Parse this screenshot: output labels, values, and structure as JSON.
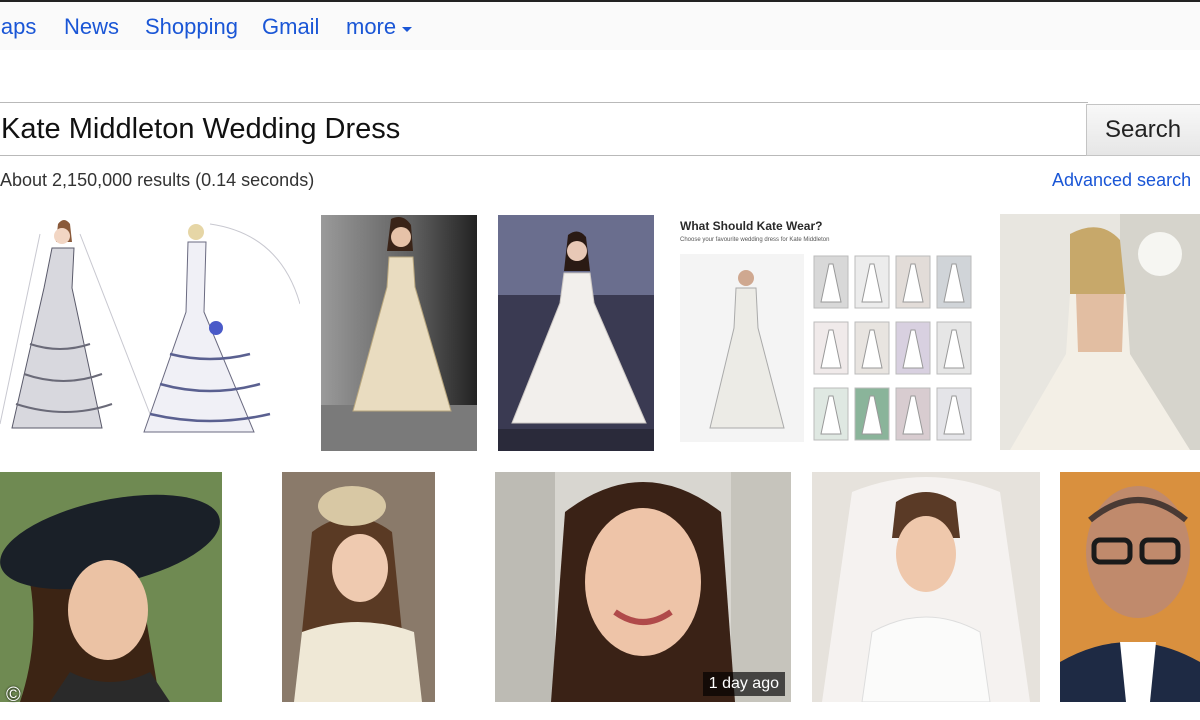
{
  "nav": {
    "maps": "laps",
    "news": "News",
    "shopping": "Shopping",
    "gmail": "Gmail",
    "more": "more"
  },
  "search": {
    "query": "Kate Middleton Wedding Dress",
    "button_label": "Search"
  },
  "results": {
    "stats": "About 2,150,000 results (0.14 seconds)",
    "advanced_link": "Advanced search"
  },
  "images": {
    "row1": [
      {
        "id": "sketch",
        "subject": "wedding dress sketches"
      },
      {
        "id": "gown-runway",
        "subject": "model in ivory gown"
      },
      {
        "id": "ballgown",
        "subject": "model in tulle ballgown"
      },
      {
        "id": "mosaic",
        "subject": "dress poll grid",
        "title": "What Should Kate Wear?",
        "subtitle": "Choose your favourite wedding dress for Kate Middleton"
      },
      {
        "id": "backless",
        "subject": "backless bridal gown"
      }
    ],
    "row2": [
      {
        "id": "hat",
        "subject": "woman in wide hat"
      },
      {
        "id": "fascinator",
        "subject": "woman with fascinator"
      },
      {
        "id": "portrait",
        "subject": "smiling woman portrait",
        "badge": "1 day ago"
      },
      {
        "id": "bride",
        "subject": "bride with veil"
      },
      {
        "id": "designer",
        "subject": "man with glasses"
      }
    ]
  },
  "watermark": "©",
  "colors": {
    "link": "#1a56d6",
    "stats_text": "#333333"
  }
}
